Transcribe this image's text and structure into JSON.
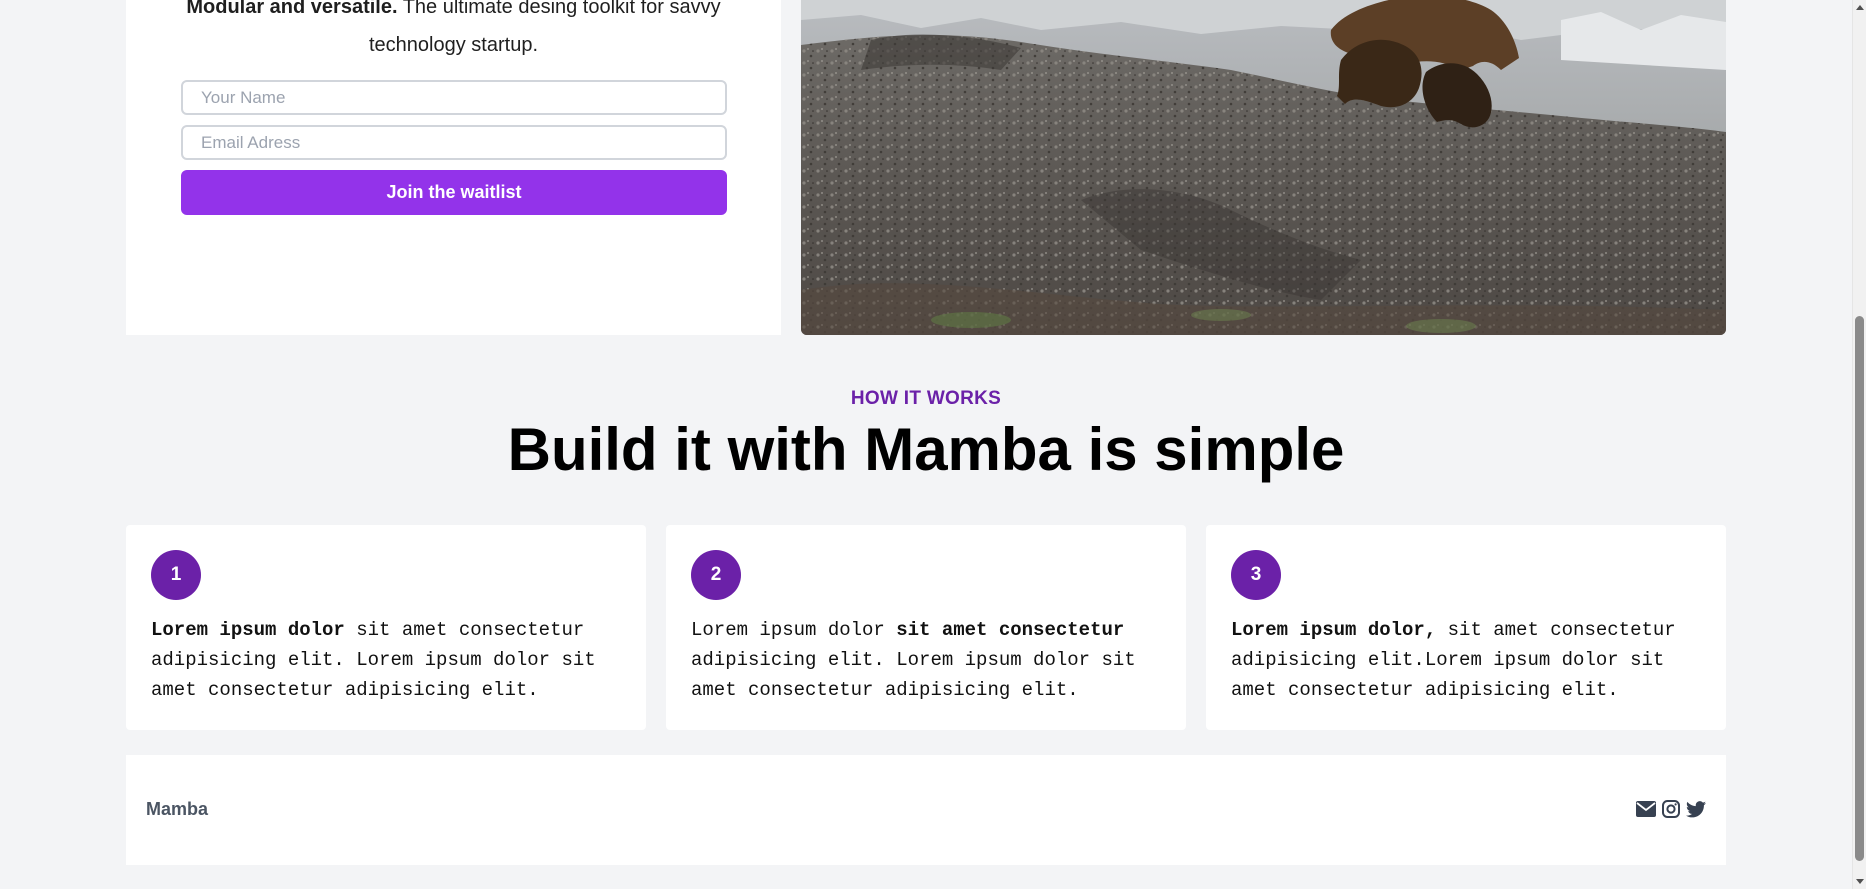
{
  "hero": {
    "tagline_bold": "Modular and versatile.",
    "tagline_line1_rest": " The ultimate desing toolkit for savvy",
    "tagline_line2": "technology startup.",
    "name_placeholder": "Your Name",
    "email_placeholder": "Email Adress",
    "join_label": "Join the waitlist",
    "accent_color": "#9333ea"
  },
  "how_it_works": {
    "eyebrow": "HOW IT WORKS",
    "headline": "Build it with Mamba is simple",
    "steps": [
      {
        "number": "1",
        "bold_lead": "Lorem ipsum dolor",
        "text_after": " sit amet consectetur adipisicing elit. Lorem ipsum dolor sit amet consectetur adipisicing elit."
      },
      {
        "number": "2",
        "text_before": "Lorem ipsum dolor ",
        "bold_mid": "sit amet consectetur",
        "text_after": " adipisicing elit. Lorem ipsum dolor sit amet consectetur adipisicing elit."
      },
      {
        "number": "3",
        "bold_lead": "Lorem ipsum dolor,",
        "text_after": " sit amet consectetur adipisicing elit.Lorem ipsum dolor sit amet consectetur adipisicing elit."
      }
    ],
    "step_color": "#6b21a8"
  },
  "footer": {
    "brand": "Mamba",
    "icons": [
      "envelope-icon",
      "instagram-icon",
      "twitter-icon"
    ]
  }
}
